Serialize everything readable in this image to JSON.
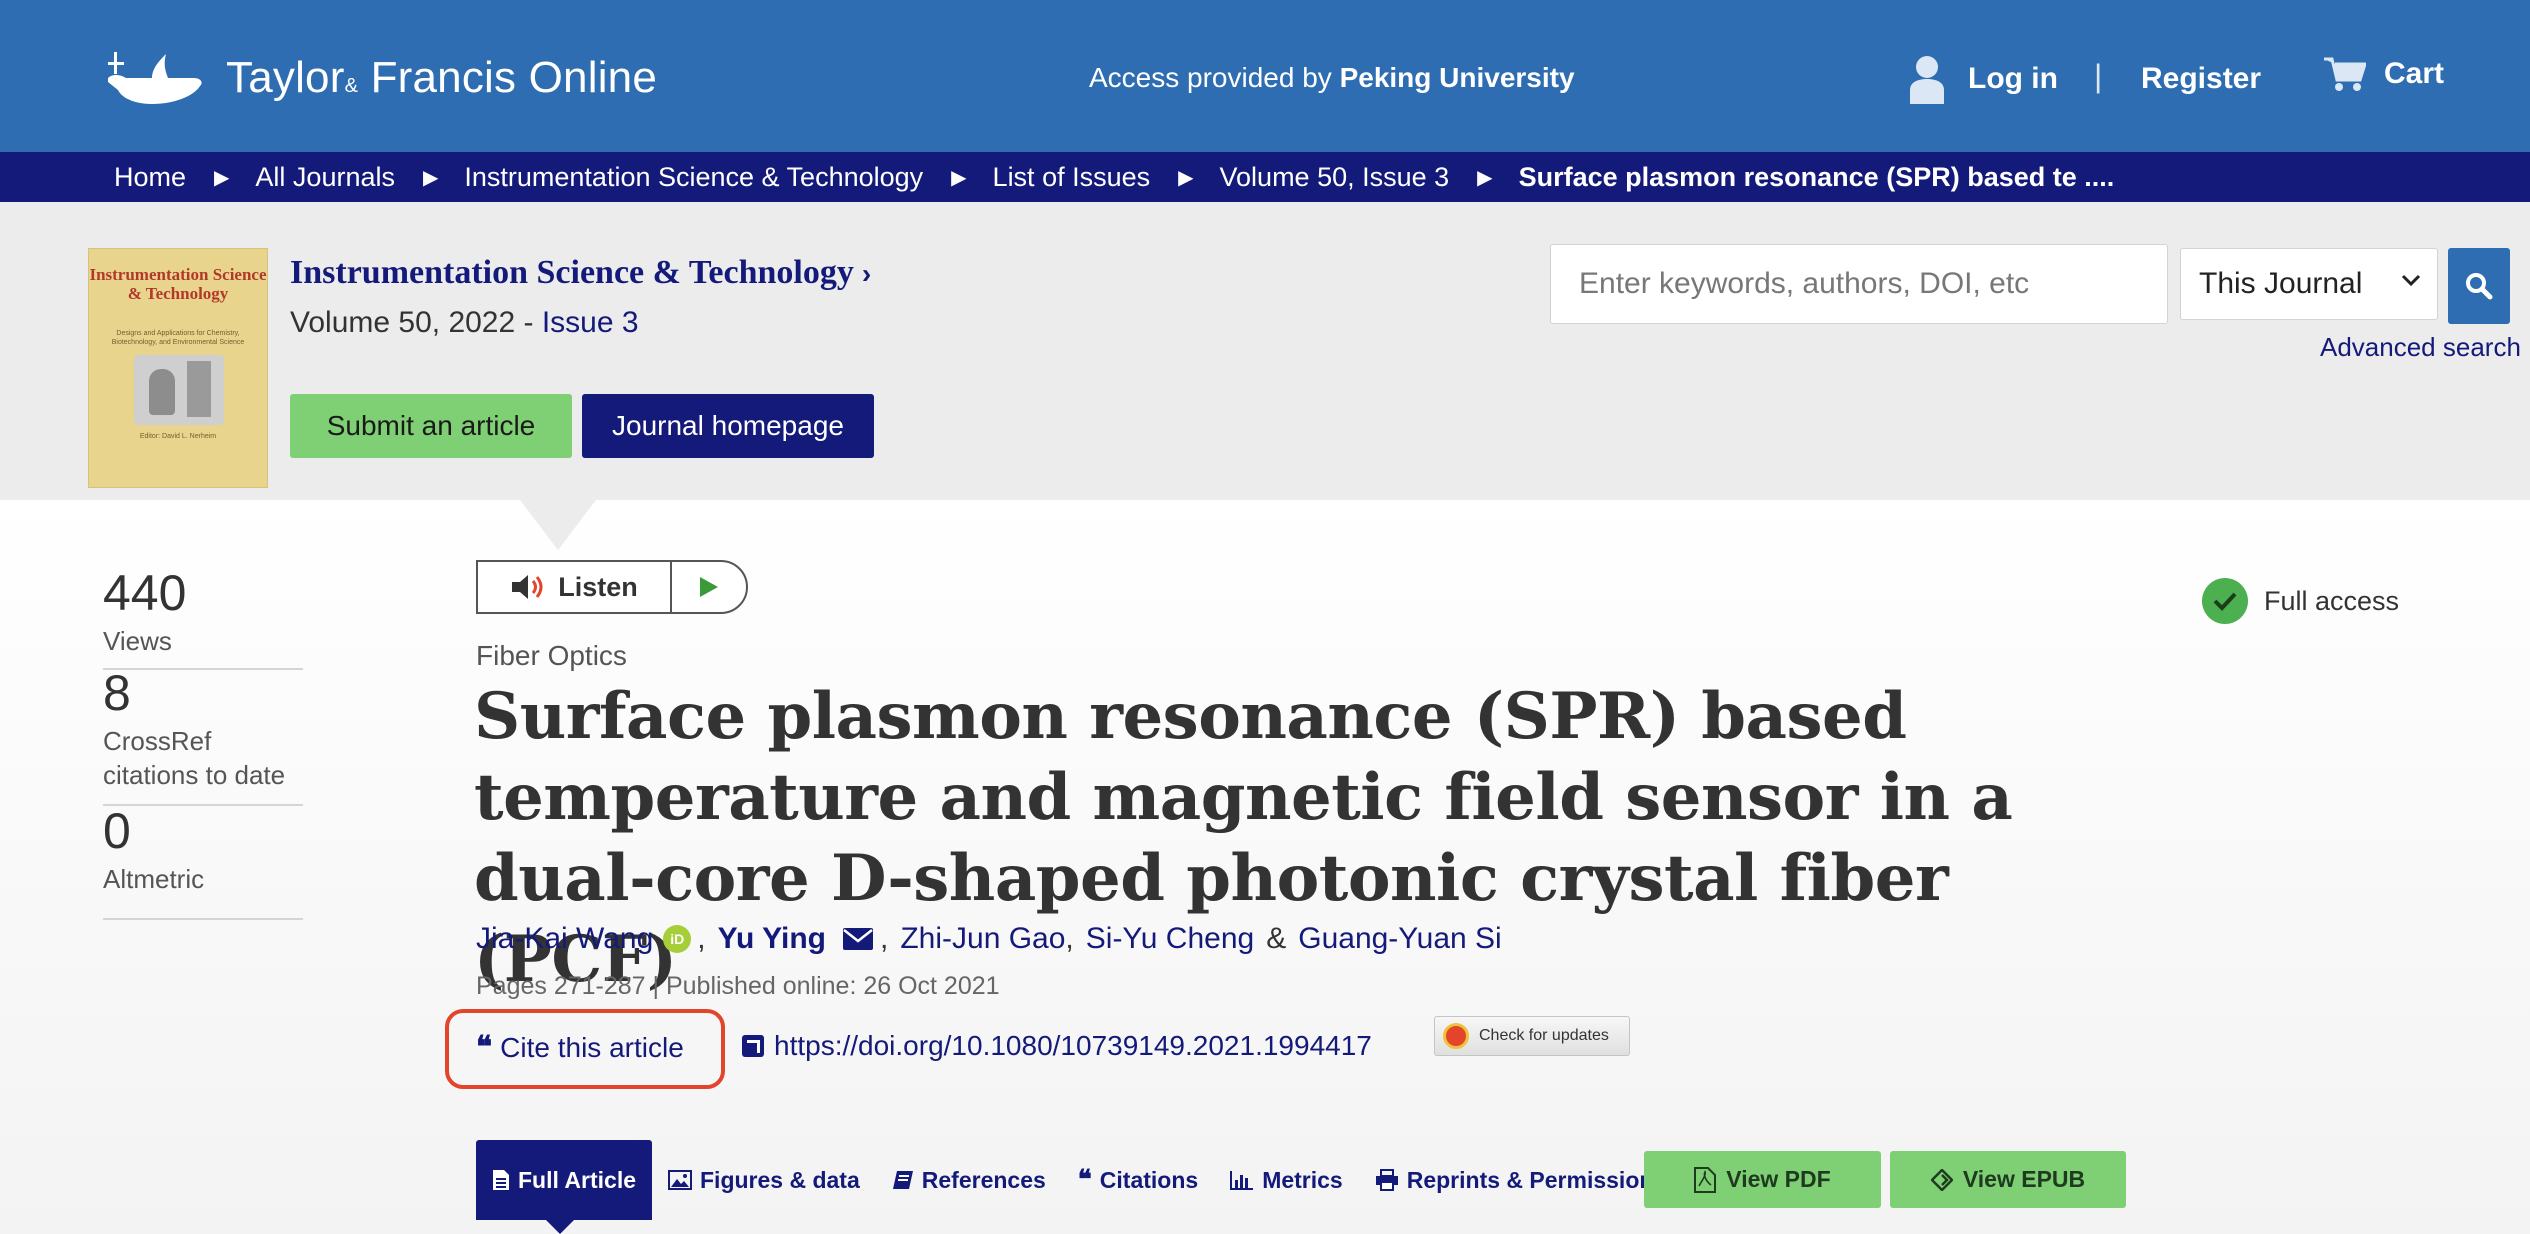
{
  "header": {
    "logo_text": "Taylor",
    "logo_amp": "&",
    "logo_text2": "Francis Online",
    "access_prefix": "Access provided by ",
    "access_institution": "Peking University",
    "login_label": "Log in",
    "separator": "|",
    "register_label": "Register",
    "cart_label": "Cart"
  },
  "breadcrumb": {
    "items": [
      "Home",
      "All Journals",
      "Instrumentation Science & Technology",
      "List of Issues",
      "Volume 50, Issue 3"
    ],
    "current": "Surface plasmon resonance (SPR) based te ...."
  },
  "journal": {
    "cover_title": "Instrumentation Science & Technology",
    "cover_subtitle": "Designs and Applications for Chemistry, Biotechnology, and Environmental Science",
    "cover_editor": "Editor: David L. Nerheim",
    "title": "Instrumentation Science & Technology",
    "chevron": "›",
    "volume_text": "Volume 50, 2022 - ",
    "issue_text": "Issue 3",
    "submit_label": "Submit an article",
    "homepage_label": "Journal homepage"
  },
  "search": {
    "placeholder": "Enter keywords, authors, DOI, etc",
    "scope_selected": "This Journal",
    "advanced_label": "Advanced search"
  },
  "metrics": {
    "views_count": "440",
    "views_label": "Views",
    "crossref_count": "8",
    "crossref_label": "CrossRef citations to date",
    "altmetric_count": "0",
    "altmetric_label": "Altmetric"
  },
  "listen": {
    "label": "Listen"
  },
  "access": {
    "label": "Full access"
  },
  "article": {
    "section": "Fiber Optics",
    "title": "Surface plasmon resonance (SPR) based temperature and magnetic field sensor in a dual-core D-shaped photonic crystal fiber (PCF)",
    "authors": {
      "a1": "Jia-Kai Wang",
      "orcid": "iD",
      "a2": "Yu Ying",
      "a3": "Zhi-Jun Gao",
      "a4": "Si-Yu Cheng",
      "amp": "&",
      "a5": "Guang-Yuan Si",
      "comma": ","
    },
    "pub_info": "Pages 271-287 | Published online: 26 Oct 2021",
    "cite_label": "Cite this article",
    "cite_quote": "❝",
    "doi": "https://doi.org/10.1080/10739149.2021.1994417",
    "updates_label": "Check for updates"
  },
  "tabs": {
    "full_article": "Full Article",
    "figures": "Figures & data",
    "references": "References",
    "citations": "Citations",
    "metrics": "Metrics",
    "reprints": "Reprints & Permissions",
    "view_pdf": "View PDF",
    "view_epub": "View EPUB"
  },
  "colors": {
    "header_blue": "#2e6db1",
    "navy": "#141a7a",
    "green_button": "#7fcf74",
    "highlight_red": "#e2452c"
  }
}
